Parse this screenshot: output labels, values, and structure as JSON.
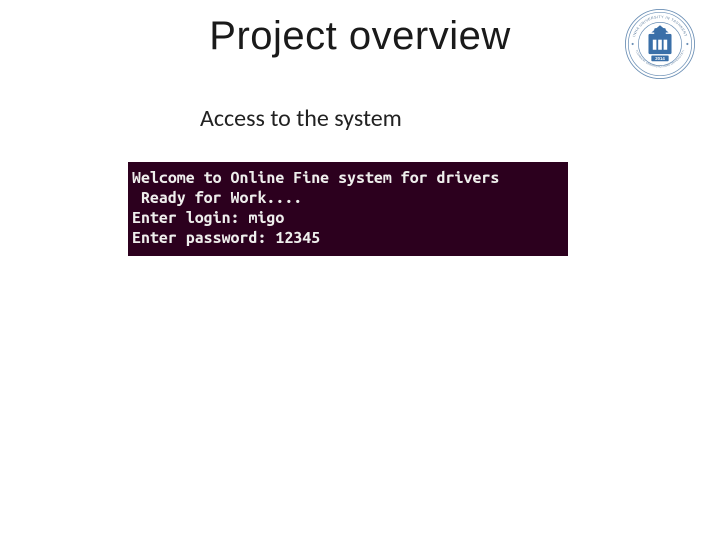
{
  "title": "Project overview",
  "subtitle": "Access to the system",
  "logo": {
    "outer_text_top": "INHA UNIVERSITY IN TASHKENT",
    "outer_text_bottom": "TOSHKENT SHAHRIDAGI INHA UNIVERSITETI",
    "year": "2014"
  },
  "terminal": {
    "lines": [
      "Welcome to Online Fine system for drivers",
      " Ready for Work....",
      "Enter login: migo",
      "Enter password: 12345"
    ]
  }
}
